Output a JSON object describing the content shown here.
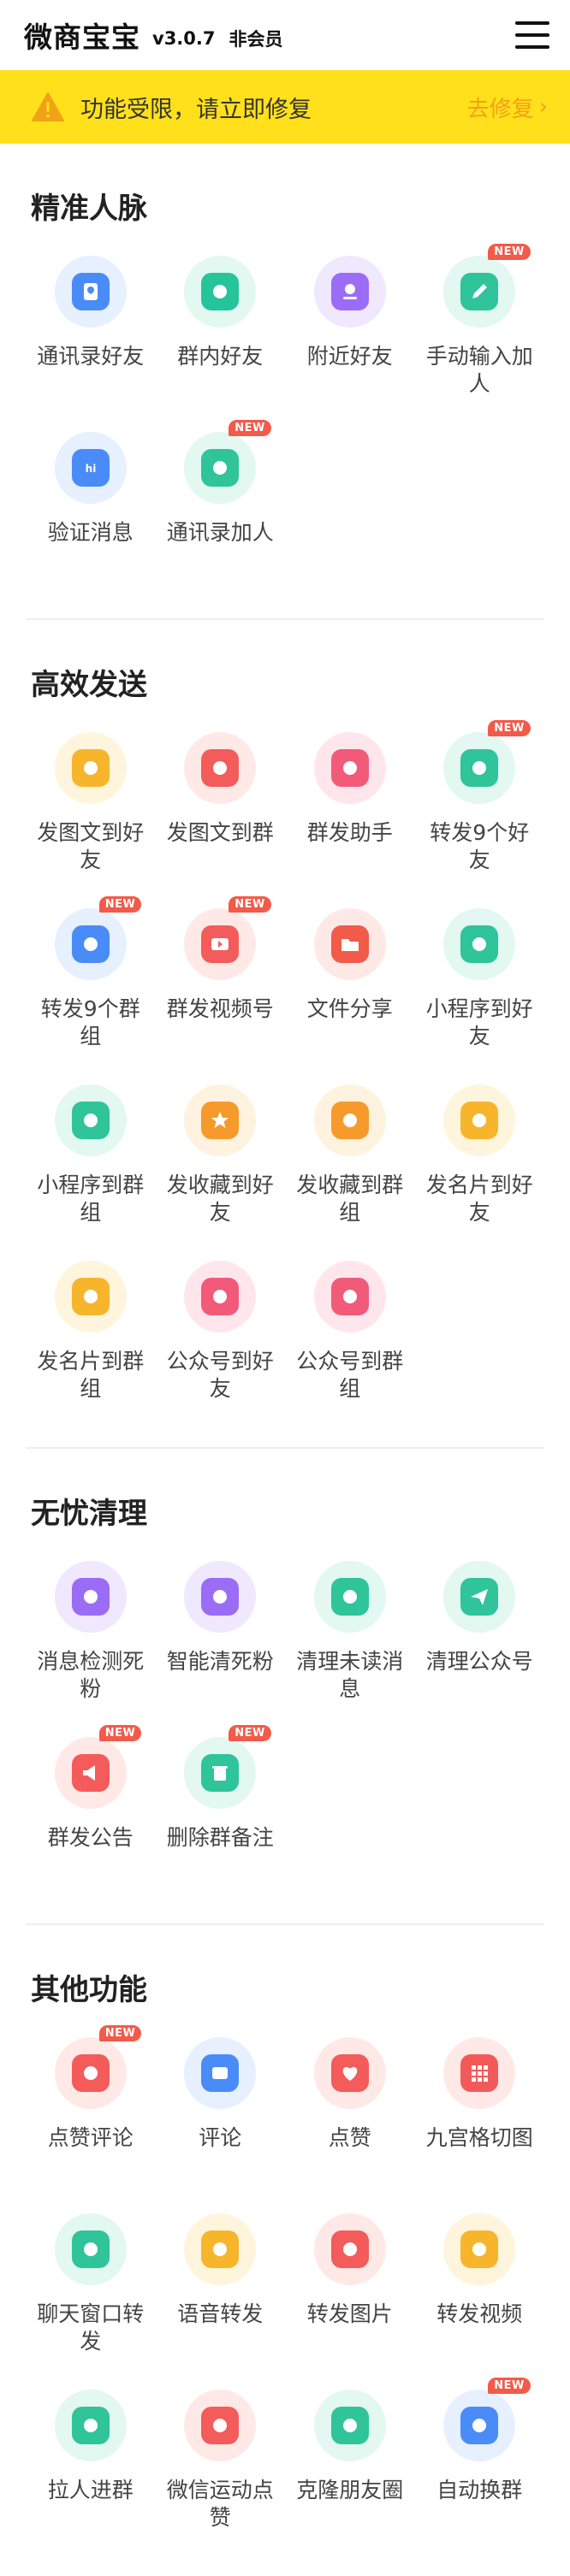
{
  "header": {
    "title": "微商宝宝",
    "version": "v3.0.7",
    "member_status": "非会员"
  },
  "warning": {
    "text": "功能受限，请立即修复",
    "action": "去修复",
    "chevron": "›"
  },
  "badge_text": "NEW",
  "sections": [
    {
      "title": "精准人脉",
      "items": [
        {
          "label": "通讯录好友",
          "icon": "contacts-icon",
          "color": "#4a8cf7",
          "halo": "#e6f0ff",
          "new": false
        },
        {
          "label": "群内好友",
          "icon": "group-add-icon",
          "color": "#25c49b",
          "halo": "#e2f8f1",
          "new": false
        },
        {
          "label": "附近好友",
          "icon": "location-icon",
          "color": "#9b6cf6",
          "halo": "#efe8ff",
          "new": false
        },
        {
          "label": "手动输入加人",
          "icon": "pencil-icon",
          "color": "#2fc49a",
          "halo": "#e2f8f1",
          "new": true
        },
        {
          "label": "验证消息",
          "icon": "hi-message-icon",
          "color": "#4a8cf7",
          "halo": "#e6f0ff",
          "new": false
        },
        {
          "label": "通讯录加人",
          "icon": "add-person-icon",
          "color": "#2fc49a",
          "halo": "#e2f8f1",
          "new": true
        }
      ]
    },
    {
      "title": "高效发送",
      "items": [
        {
          "label": "发图文到好友",
          "icon": "image-text-icon",
          "color": "#f7b52c",
          "halo": "#fff5dc",
          "new": false
        },
        {
          "label": "发图文到群",
          "icon": "image-text-group-icon",
          "color": "#f45b5b",
          "halo": "#ffe9e6",
          "new": false
        },
        {
          "label": "群发助手",
          "icon": "broadcast-icon",
          "color": "#f25a7a",
          "halo": "#ffe6ec",
          "new": false
        },
        {
          "label": "转发9个好友",
          "icon": "forward-friends-icon",
          "color": "#2fc49a",
          "halo": "#e2f8f1",
          "new": true
        },
        {
          "label": "转发9个群组",
          "icon": "forward-groups-icon",
          "color": "#4a8cf7",
          "halo": "#e6f0ff",
          "new": true
        },
        {
          "label": "群发视频号",
          "icon": "video-icon",
          "color": "#f45b5b",
          "halo": "#ffe9e6",
          "new": true
        },
        {
          "label": "文件分享",
          "icon": "folder-icon",
          "color": "#f25a4a",
          "halo": "#ffe9e6",
          "new": false
        },
        {
          "label": "小程序到好友",
          "icon": "miniprogram-icon",
          "color": "#2fc49a",
          "halo": "#e2f8f1",
          "new": false
        },
        {
          "label": "小程序到群组",
          "icon": "miniprogram-group-icon",
          "color": "#2fc49a",
          "halo": "#e2f8f1",
          "new": false
        },
        {
          "label": "发收藏到好友",
          "icon": "star-icon",
          "color": "#f79a2c",
          "halo": "#fff2df",
          "new": false
        },
        {
          "label": "发收藏到群组",
          "icon": "star-circle-icon",
          "color": "#f79a2c",
          "halo": "#fff2df",
          "new": false
        },
        {
          "label": "发名片到好友",
          "icon": "card-icon",
          "color": "#f7b52c",
          "halo": "#fff5dc",
          "new": false
        },
        {
          "label": "发名片到群组",
          "icon": "card-circle-icon",
          "color": "#f7b52c",
          "halo": "#fff5dc",
          "new": false
        },
        {
          "label": "公众号到好友",
          "icon": "official-account-icon",
          "color": "#f25a7a",
          "halo": "#ffe6ec",
          "new": false
        },
        {
          "label": "公众号到群组",
          "icon": "official-account-group-icon",
          "color": "#f25a7a",
          "halo": "#ffe6ec",
          "new": false
        }
      ]
    },
    {
      "title": "无忧清理",
      "items": [
        {
          "label": "消息检测死粉",
          "icon": "ghost-check-icon",
          "color": "#9b6cf6",
          "halo": "#efe8ff",
          "new": false
        },
        {
          "label": "智能清死粉",
          "icon": "lightning-clean-icon",
          "color": "#9b6cf6",
          "halo": "#efe8ff",
          "new": false
        },
        {
          "label": "清理未读消息",
          "icon": "unread-message-icon",
          "color": "#2fc49a",
          "halo": "#e2f8f1",
          "new": false
        },
        {
          "label": "清理公众号",
          "icon": "send-plane-icon",
          "color": "#2fc49a",
          "halo": "#e2f8f1",
          "new": false
        },
        {
          "label": "群发公告",
          "icon": "megaphone-icon",
          "color": "#f45b5b",
          "halo": "#ffe9e6",
          "new": true
        },
        {
          "label": "删除群备注",
          "icon": "trash-icon",
          "color": "#2fc49a",
          "halo": "#e2f8f1",
          "new": true
        }
      ]
    },
    {
      "title": "其他功能",
      "items": [
        {
          "label": "点赞评论",
          "icon": "like-comment-icon",
          "color": "#f45b5b",
          "halo": "#ffe9e6",
          "new": true
        },
        {
          "label": "评论",
          "icon": "comment-icon",
          "color": "#4a8cf7",
          "halo": "#e6f0ff",
          "new": false
        },
        {
          "label": "点赞",
          "icon": "heart-icon",
          "color": "#f45b5b",
          "halo": "#ffe9e6",
          "new": false
        },
        {
          "label": "九宫格切图",
          "icon": "grid-icon",
          "color": "#f25a5a",
          "halo": "#ffe9e6",
          "new": false
        },
        {
          "label": "聊天窗口转发",
          "icon": "chat-forward-icon",
          "color": "#2fc49a",
          "halo": "#e2f8f1",
          "new": false
        },
        {
          "label": "语音转发",
          "icon": "voice-icon",
          "color": "#f7b52c",
          "halo": "#fff5dc",
          "new": false
        },
        {
          "label": "转发图片",
          "icon": "image-forward-icon",
          "color": "#f45b5b",
          "halo": "#ffe9e6",
          "new": false
        },
        {
          "label": "转发视频",
          "icon": "video-forward-icon",
          "color": "#f7b52c",
          "halo": "#fff5dc",
          "new": false
        },
        {
          "label": "拉人进群",
          "icon": "invite-icon",
          "color": "#2fc49a",
          "halo": "#e2f8f1",
          "new": false
        },
        {
          "label": "微信运动点赞",
          "icon": "sport-like-icon",
          "color": "#f45b5b",
          "halo": "#ffe9e6",
          "new": false
        },
        {
          "label": "克隆朋友圈",
          "icon": "moments-clone-icon",
          "color": "#2fc49a",
          "halo": "#e2f8f1",
          "new": false
        },
        {
          "label": "自动换群",
          "icon": "auto-switch-group-icon",
          "color": "#4a8cf7",
          "halo": "#e6f0ff",
          "new": true
        }
      ]
    }
  ]
}
